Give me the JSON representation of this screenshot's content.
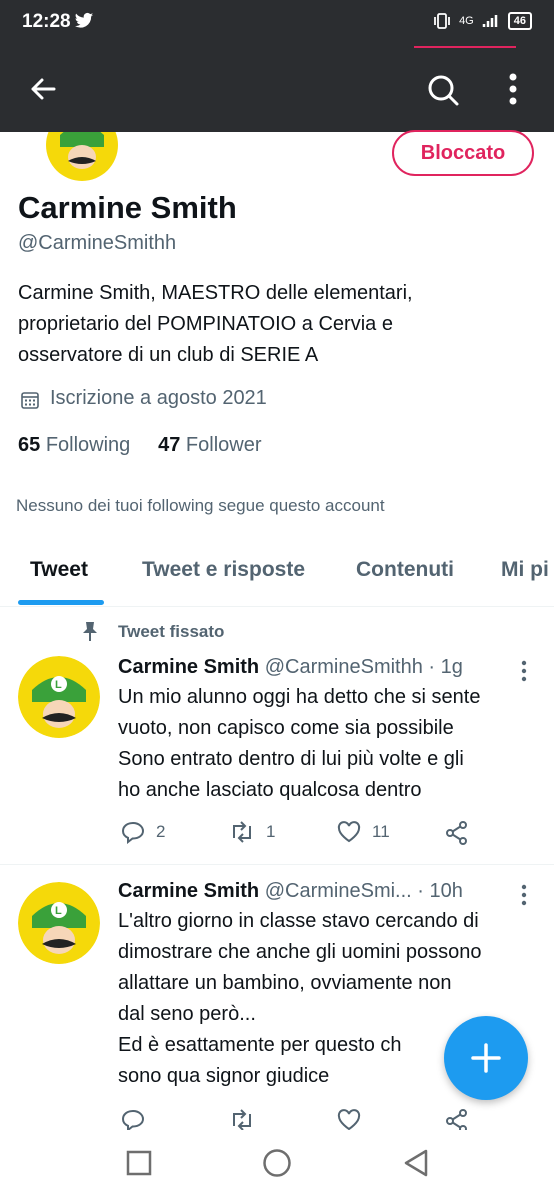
{
  "status": {
    "time": "12:28",
    "network": "4G",
    "battery": "46"
  },
  "profile": {
    "name": "Carmine Smith",
    "handle": "@CarmineSmithh",
    "blocked_label": "Bloccato",
    "bio_lines": [
      "Carmine Smith, MAESTRO delle elementari,",
      "proprietario del POMPINATOIO a Cervia e",
      "osservatore di un club di SERIE A"
    ],
    "joined": "Iscrizione a agosto 2021",
    "following_count": "65",
    "following_label": "Following",
    "follower_count": "47",
    "follower_label": "Follower",
    "mutuals_note": "Nessuno dei tuoi following segue questo account"
  },
  "tabs": [
    "Tweet",
    "Tweet e risposte",
    "Contenuti",
    "Mi pi"
  ],
  "pinned_label": "Tweet fissato",
  "tweets": [
    {
      "name": "Carmine Smith",
      "meta": "@CarmineSmithh · 1g",
      "lines": [
        "Un mio alunno oggi ha detto che si sente",
        "vuoto, non capisco come sia possibile",
        "Sono entrato dentro di lui più volte e gli",
        "ho anche lasciato qualcosa dentro"
      ],
      "replies": "2",
      "retweets": "1",
      "likes": "11"
    },
    {
      "name": "Carmine Smith",
      "meta": "@CarmineSmi... · 10h",
      "lines": [
        "L'altro giorno in classe stavo cercando di",
        "dimostrare che anche gli uomini possono",
        "allattare un bambino, ovviamente non",
        "dal seno però...",
        "Ed è esattamente per questo ch",
        "sono qua signor giudice"
      ]
    }
  ],
  "colors": {
    "accent": "#1d9bf0",
    "blocked": "#e0245e",
    "bar": "#2b2d30"
  }
}
